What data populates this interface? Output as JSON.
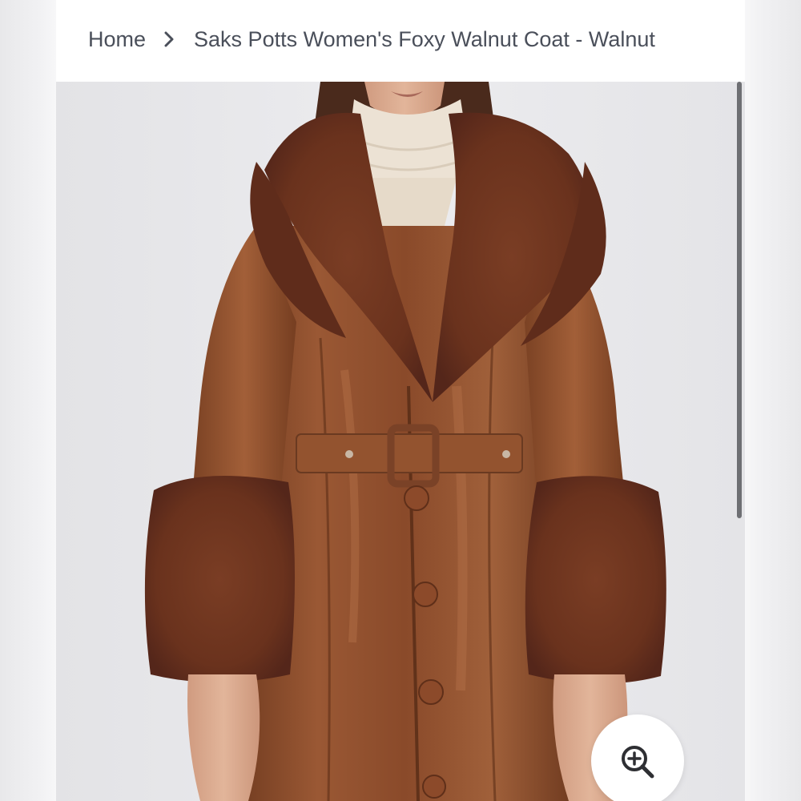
{
  "breadcrumb": {
    "home_label": "Home",
    "separator_icon": "chevron-right-icon",
    "current_label": "Saks Potts Women's Foxy Walnut Coat - Walnut"
  },
  "product_image": {
    "alt": "Saks Potts Women's Foxy Walnut Coat - Walnut"
  },
  "zoom": {
    "icon": "zoom-in-icon",
    "aria_label": "Zoom"
  },
  "colors": {
    "text": "#4a4f5a",
    "image_background": "#e7e7ea",
    "coat_leather": "#8a4a2a",
    "fur": "#6b3420",
    "turtleneck": "#ece2d4",
    "scroll_thumb": "#6e6f73"
  }
}
